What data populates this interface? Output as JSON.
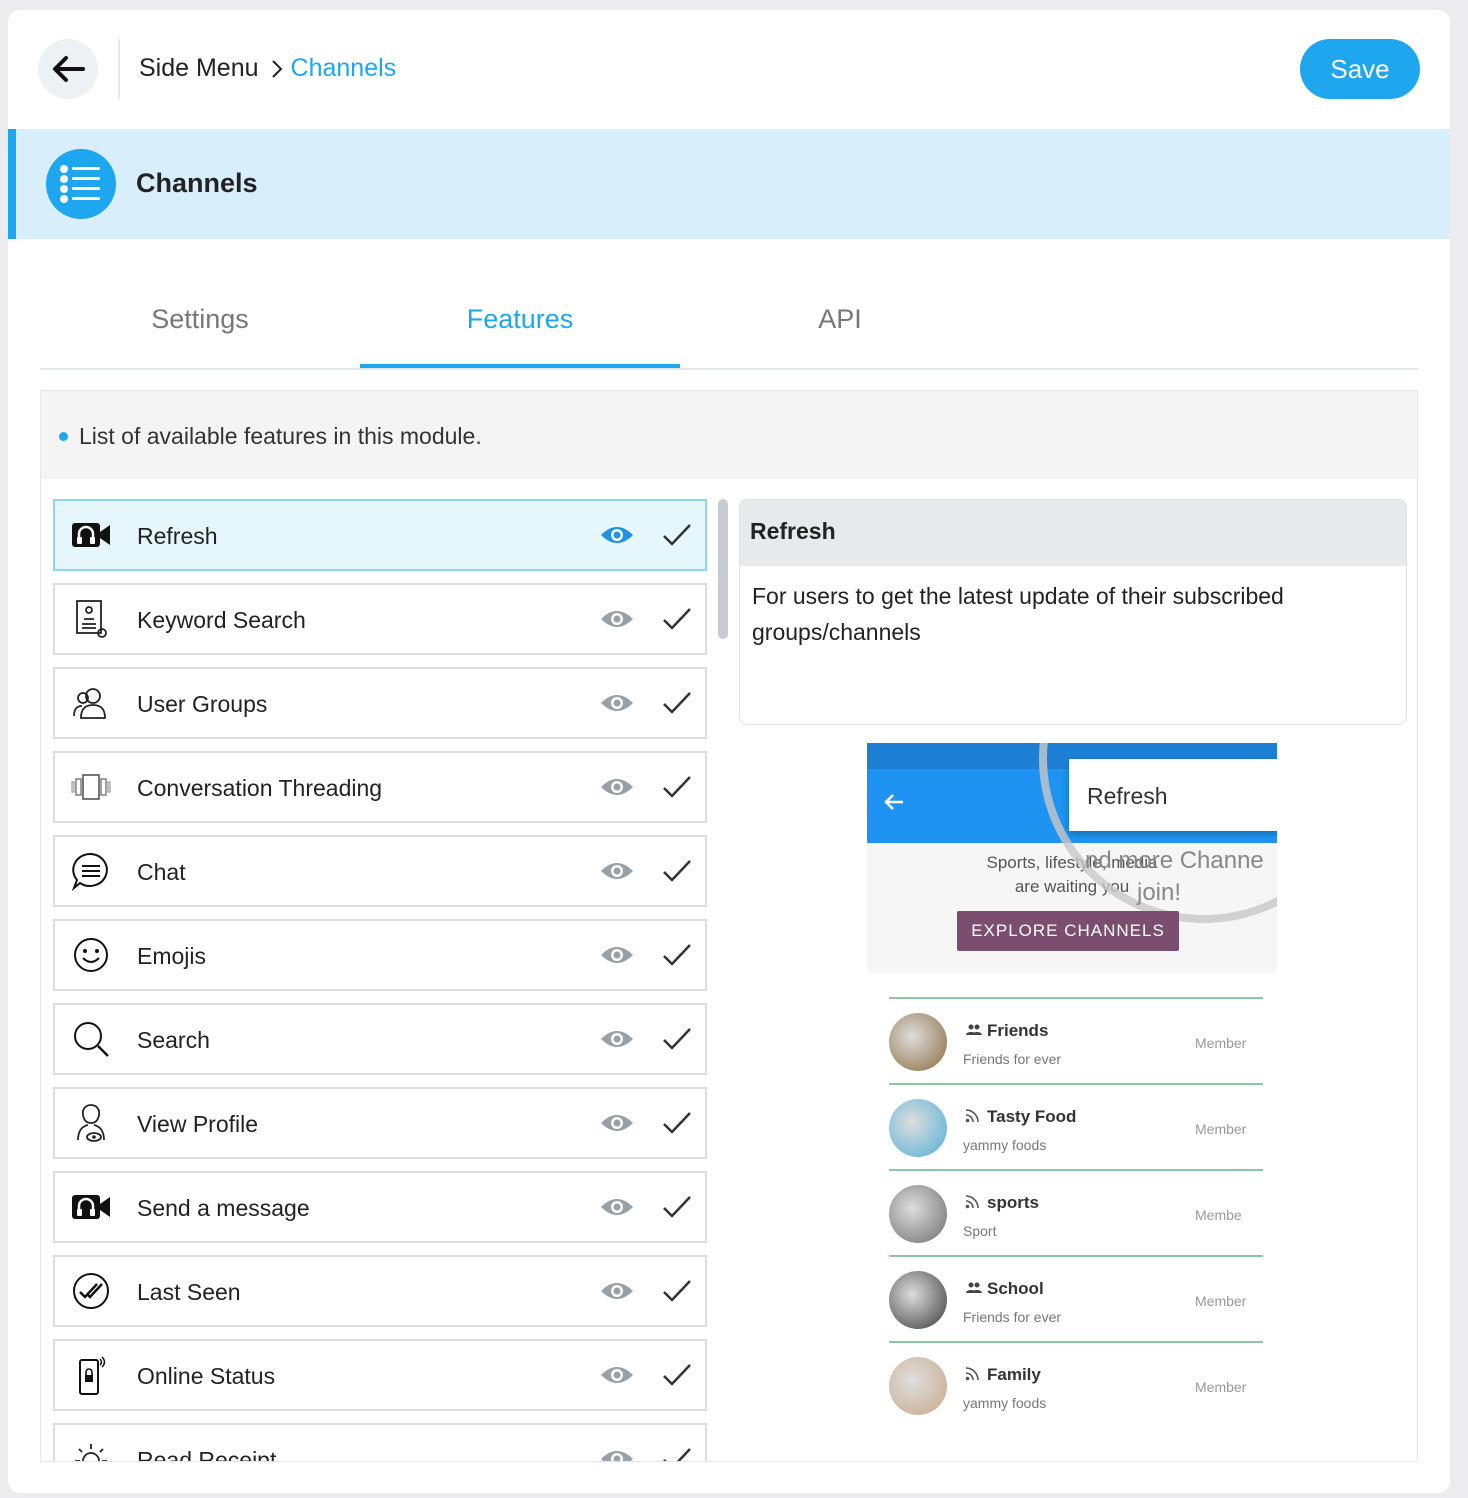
{
  "header": {
    "breadcrumb_root": "Side Menu",
    "breadcrumb_current": "Channels",
    "save_label": "Save"
  },
  "module": {
    "title": "Channels"
  },
  "tabs": [
    {
      "label": "Settings",
      "active": false
    },
    {
      "label": "Features",
      "active": true
    },
    {
      "label": "API",
      "active": false
    }
  ],
  "features_panel": {
    "info_text": "List of available features in this module.",
    "items": [
      {
        "label": "Refresh",
        "icon": "video-call-icon",
        "active": true
      },
      {
        "label": "Keyword Search",
        "icon": "document-search-icon",
        "active": false
      },
      {
        "label": "User Groups",
        "icon": "user-group-icon",
        "active": false
      },
      {
        "label": "Conversation Threading",
        "icon": "threading-icon",
        "active": false
      },
      {
        "label": "Chat",
        "icon": "chat-bubble-icon",
        "active": false
      },
      {
        "label": "Emojis",
        "icon": "smiley-icon",
        "active": false
      },
      {
        "label": "Search",
        "icon": "magnifier-icon",
        "active": false
      },
      {
        "label": "View Profile",
        "icon": "profile-view-icon",
        "active": false
      },
      {
        "label": "Send a message",
        "icon": "video-call-icon",
        "active": false
      },
      {
        "label": "Last Seen",
        "icon": "double-check-icon",
        "active": false
      },
      {
        "label": "Online Status",
        "icon": "mobile-status-icon",
        "active": false
      },
      {
        "label": "Read Receipt",
        "icon": "sun-icon",
        "active": false
      }
    ]
  },
  "detail": {
    "title": "Refresh",
    "description": "For users to get the latest update of their subscribed groups/channels"
  },
  "preview": {
    "menu_item": "Refresh",
    "hero_line1": "Sports, lifestyle, media",
    "hero_big": "nd more Channe",
    "hero_line2": "are waiting you",
    "hero_big2": "join!",
    "explore_label": "EXPLORE CHANNELS",
    "channels": [
      {
        "name": "Friends",
        "sub": "Friends for ever",
        "role": "Member",
        "kind": "group-icon",
        "avatar_color": "#8a6a3c"
      },
      {
        "name": "Tasty Food",
        "sub": "yammy foods",
        "role": "Member",
        "kind": "rss-icon",
        "avatar_color": "#4fb0d8"
      },
      {
        "name": "sports",
        "sub": "Sport",
        "role": "Membe",
        "kind": "rss-icon",
        "avatar_color": "#6d6d6d"
      },
      {
        "name": "School",
        "sub": "Friends for ever",
        "role": "Member",
        "kind": "group-icon",
        "avatar_color": "#3a3a3a"
      },
      {
        "name": "Family",
        "sub": "yammy foods",
        "role": "Member",
        "kind": "rss-icon",
        "avatar_color": "#c9a98a"
      }
    ]
  },
  "colors": {
    "accent": "#1ea7ee",
    "banner_bg": "#d9eefb",
    "active_row_bg": "#e6f6fd",
    "explore_button": "#7b4d6f"
  }
}
